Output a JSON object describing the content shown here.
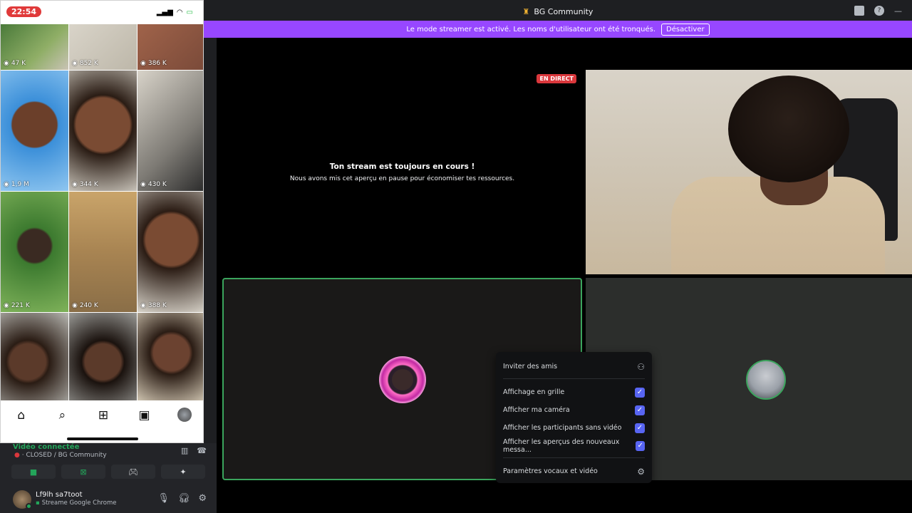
{
  "titlebar": {
    "title": "BG Community"
  },
  "banner": {
    "text": "Le mode streamer est activé. Les noms d'utilisateur ont été tronqués.",
    "button": "Désactiver"
  },
  "stream": {
    "badge": "EN DIRECT",
    "heading": "Ton stream est toujours en cours !",
    "subtext": "Nous avons mis cet aperçu en pause pour économiser tes ressources."
  },
  "menu": {
    "invite": "Inviter des amis",
    "options": [
      {
        "label": "Affichage en grille",
        "checked": true
      },
      {
        "label": "Afficher ma caméra",
        "checked": true
      },
      {
        "label": "Afficher les participants sans vidéo",
        "checked": true
      },
      {
        "label": "Afficher les aperçus des nouveaux messa...",
        "checked": true
      }
    ],
    "settings": "Paramètres vocaux et vidéo"
  },
  "phone": {
    "time": "22:54",
    "views": [
      "47 K",
      "852 K",
      "386 K",
      "1,9 M",
      "344 K",
      "430 K",
      "221 K",
      "240 K",
      "388 K"
    ]
  },
  "voice": {
    "status": "Vidéo connectée",
    "channel": "CLOSED / BG Community"
  },
  "user": {
    "name": "Lf9lh sa7toot",
    "activity": "Streame Google Chrome"
  },
  "colors": {
    "accent": "#5865f2",
    "live": "#da373c",
    "connected": "#23a55a",
    "banner": "#9747ff"
  }
}
